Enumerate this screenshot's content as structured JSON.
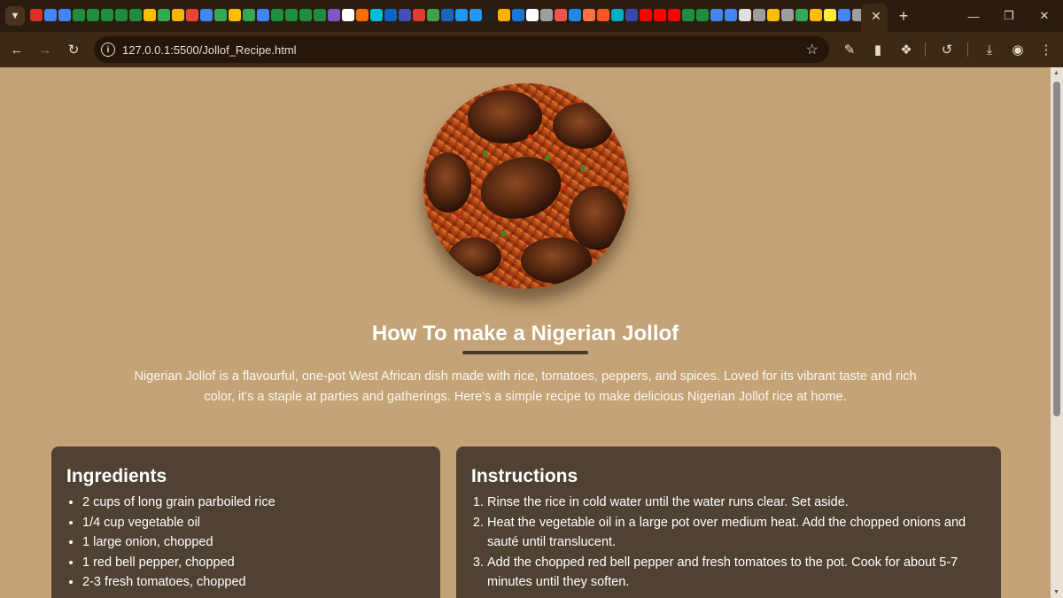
{
  "browser": {
    "url": "127.0.0.1:5500/Jollof_Recipe.html",
    "favicon_colors": [
      "#d93025",
      "#4285f4",
      "#4285f4",
      "#1e8e3e",
      "#1e8e3e",
      "#1e8e3e",
      "#1e8e3e",
      "#1e8e3e",
      "#fbbc04",
      "#34a853",
      "#f4b400",
      "#ea4335",
      "#4285f4",
      "#34a853",
      "#fbbc04",
      "#34a853",
      "#4285f4",
      "#1e8e3e",
      "#1e8e3e",
      "#1e8e3e",
      "#1e8e3e",
      "#7e57c2",
      "#ffffff",
      "#ff6d00",
      "#00bcd4",
      "#0a66c2",
      "#3f51b5",
      "#e53935",
      "#43a047",
      "#1565c0",
      "#2196f3",
      "#2196f3",
      "#212121",
      "#ffb300",
      "#1976d2",
      "#ffffff",
      "#9e9e9e",
      "#ef5350",
      "#1e88e5",
      "#ff7043",
      "#ff5722",
      "#00acc1",
      "#3949ab",
      "#ff0000",
      "#ff0000",
      "#ff0000",
      "#1e8e3e",
      "#1e8e3e",
      "#4285f4",
      "#4285f4",
      "#e0e0e0",
      "#9e9e9e",
      "#fbbc04",
      "#9e9e9e",
      "#34a853",
      "#fbbc04",
      "#ffeb3b",
      "#4285f4",
      "#9e9e9e",
      "#bdbdbd",
      "#bdbdbd"
    ]
  },
  "recipe": {
    "title": "How To make a Nigerian Jollof",
    "intro": "Nigerian Jollof is a flavourful, one-pot West African dish made with rice, tomatoes, peppers, and spices. Loved for its vibrant taste and rich color, it's a staple at parties and gatherings. Here's a simple recipe to make delicious Nigerian Jollof rice at home.",
    "ingredients_heading": "Ingredients",
    "ingredients": [
      "2 cups of long grain parboiled rice",
      "1/4 cup vegetable oil",
      "1 large onion, chopped",
      "1 red bell pepper, chopped",
      "2-3 fresh tomatoes, chopped"
    ],
    "instructions_heading": "Instructions",
    "instructions": [
      "Rinse the rice in cold water until the water runs clear. Set aside.",
      "Heat the vegetable oil in a large pot over medium heat. Add the chopped onions and sauté until translucent.",
      "Add the chopped red bell pepper and fresh tomatoes to the pot. Cook for about 5-7 minutes until they soften."
    ]
  }
}
